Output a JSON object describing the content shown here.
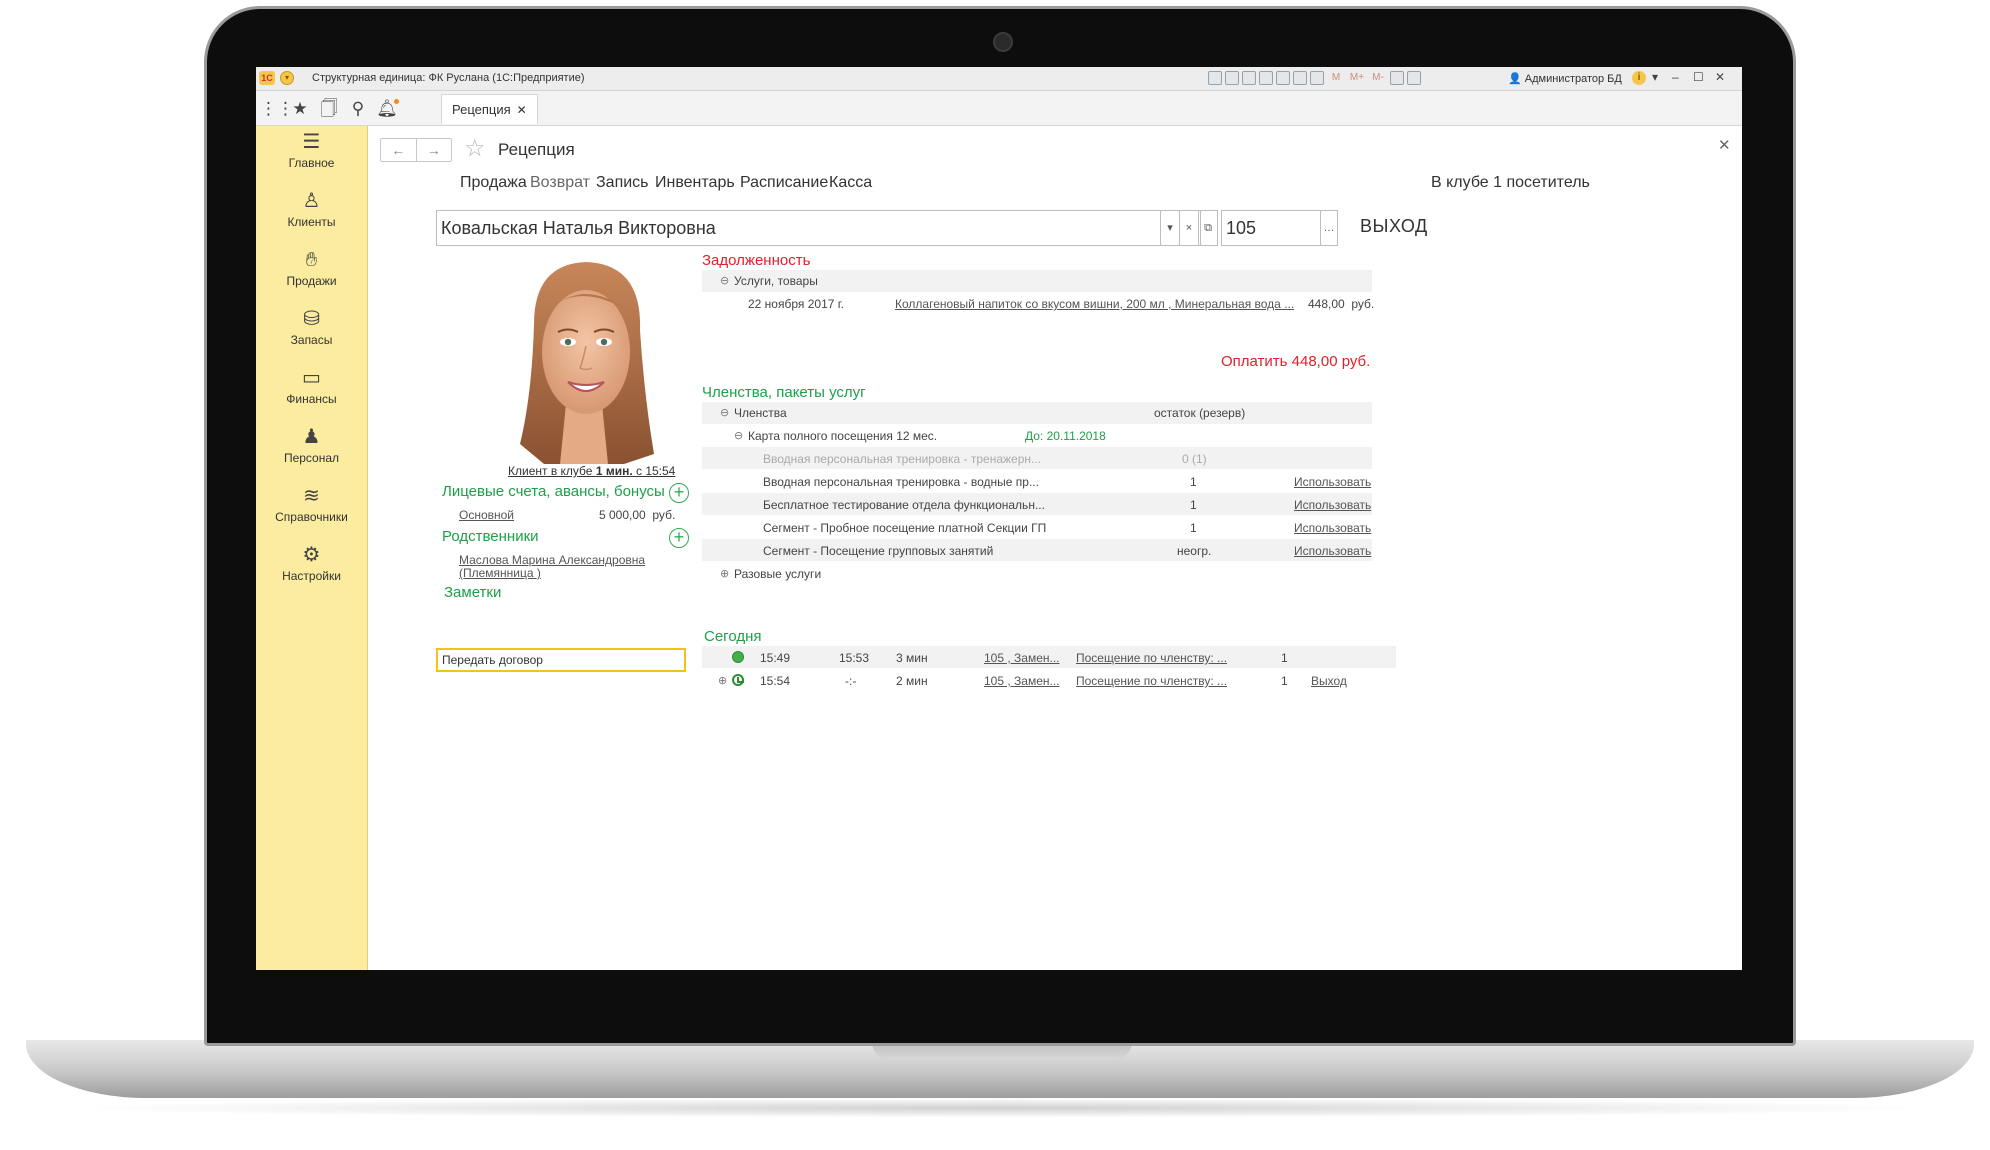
{
  "window": {
    "title": "Структурная единица: ФК Руслана  (1С:Предприятие)",
    "logo": "1C",
    "user": "Администратор БД",
    "icon_labels": [
      "M",
      "M+",
      "M-"
    ]
  },
  "toolbar": {
    "tab_label": "Рецепция"
  },
  "sidebar": {
    "items": [
      {
        "label": "Главное",
        "icon": "menu-icon"
      },
      {
        "label": "Клиенты",
        "icon": "clients-icon"
      },
      {
        "label": "Продажи",
        "icon": "sales-icon"
      },
      {
        "label": "Запасы",
        "icon": "stock-icon"
      },
      {
        "label": "Финансы",
        "icon": "wallet-icon"
      },
      {
        "label": "Персонал",
        "icon": "staff-icon"
      },
      {
        "label": "Справочники",
        "icon": "layers-icon"
      },
      {
        "label": "Настройки",
        "icon": "gear-icon"
      }
    ]
  },
  "page": {
    "title": "Рецепция",
    "nav": [
      "Продажа",
      "Возврат",
      "Запись",
      "Инвентарь",
      "Расписание",
      "Касса"
    ],
    "visitors": "В клубе 1 посетитель",
    "client_name": "Ковальская Наталья Викторовна",
    "card_number": "105",
    "exit_label": "ВЫХОД"
  },
  "left": {
    "status_pre": "Клиент в клубе ",
    "status_bold": "1 мин.",
    "status_post": " с 15:54",
    "accounts_title": "Лицевые счета, авансы, бонусы",
    "account_name": "Основной",
    "account_amount": "5 000,00",
    "account_currency": "руб.",
    "relatives_title": "Родственники",
    "relative_name": "Маслова Марина Александровна",
    "relative_role": "(Племянница )",
    "notes_title": "Заметки",
    "notes_value": "Передать договор"
  },
  "debt": {
    "title": "Задолженность",
    "group": "Услуги, товары",
    "date": "22 ноября 2017 г.",
    "items": "Коллагеновый напиток со вкусом вишни, 200 мл , Минеральная вода ...",
    "amount": "448,00",
    "currency": "руб.",
    "pay": "Оплатить 448,00  руб."
  },
  "memberships": {
    "title": "Членства, пакеты услуг",
    "group": "Членства",
    "remainder_header": "остаток (резерв)",
    "card": "Карта полного посещения 12 мес.",
    "card_until": "До: 20.11.2018",
    "rows": [
      {
        "name": "Вводная персональная тренировка - тренажерн...",
        "qty": "0 (1)",
        "action": ""
      },
      {
        "name": "Вводная персональная тренировка - водные пр...",
        "qty": "1",
        "action": "Использовать"
      },
      {
        "name": "Бесплатное тестирование отдела функциональн...",
        "qty": "1",
        "action": "Использовать"
      },
      {
        "name": "Сегмент - Пробное посещение платной Секции ГП",
        "qty": "1",
        "action": "Использовать"
      },
      {
        "name": "Сегмент - Посещение групповых занятий",
        "qty": "неогр.",
        "action": "Использовать"
      }
    ],
    "one_time": "Разовые услуги"
  },
  "today": {
    "title": "Сегодня",
    "rows": [
      {
        "start": "15:49",
        "end": "15:53",
        "duration": "3 мин",
        "card": "105 , Замен...",
        "visit": "Посещение по членству: ...",
        "count": "1",
        "action": ""
      },
      {
        "start": "15:54",
        "end": "-:-",
        "duration": "2 мин",
        "card": "105 , Замен...",
        "visit": "Посещение по членству: ...",
        "count": "1",
        "action": "Выход"
      }
    ]
  },
  "colors": {
    "sidebar": "#fbec9f",
    "green": "#1ea04a",
    "red": "#e0202a",
    "accent": "#f2c318"
  }
}
